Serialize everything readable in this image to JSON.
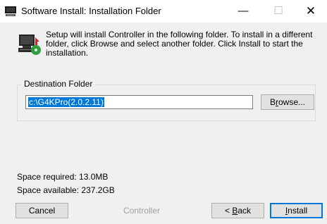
{
  "window": {
    "title": "Software Install: Installation Folder",
    "controls": {
      "minimize": "—",
      "maximize": "☐",
      "close": "✕"
    }
  },
  "intro_text": "Setup will install Controller in the following folder. To install in a different folder, click Browse and select another folder. Click Install to start the installation.",
  "destination": {
    "group_label": "Destination Folder",
    "path_value": "c:\\G4KPro(2.0.2.11)",
    "browse_prefix": "B",
    "browse_underlined": "r",
    "browse_suffix": "owse..."
  },
  "space": {
    "required": "Space required: 13.0MB",
    "available": "Space available: 237.2GB"
  },
  "footer": {
    "cancel_label": "Cancel",
    "branding": "Controller",
    "back_prefix": "< ",
    "back_underlined": "B",
    "back_suffix": "ack",
    "install_underlined": "I",
    "install_suffix": "nstall"
  },
  "colors": {
    "accent": "#0078d7",
    "background": "#f0f0f0",
    "disabled_text": "#a0a0a0"
  },
  "icons": {
    "app": "computer-icon",
    "header": "install-computer-icon"
  }
}
